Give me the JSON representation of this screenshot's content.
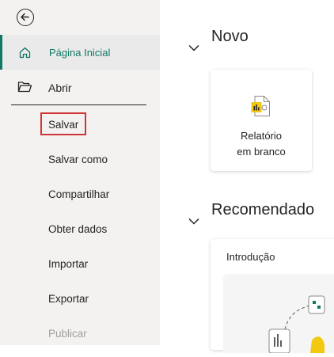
{
  "sidebar": {
    "home_label": "Página Inicial",
    "open_label": "Abrir",
    "items": [
      {
        "label": "Salvar"
      },
      {
        "label": "Salvar como"
      },
      {
        "label": "Compartilhar"
      },
      {
        "label": "Obter dados"
      },
      {
        "label": "Importar"
      },
      {
        "label": "Exportar"
      },
      {
        "label": "Publicar",
        "disabled": true
      }
    ]
  },
  "main": {
    "new_section": {
      "title": "Novo",
      "card_label_line1": "Relatório",
      "card_label_line2": "em branco"
    },
    "recommended_section": {
      "title": "Recomendado",
      "card_label": "Introdução"
    }
  },
  "colors": {
    "accent": "#117865",
    "highlight_border": "#d13438",
    "sidebar_bg": "#f3f2f1",
    "powerbi_yellow": "#f2c811"
  },
  "icons": {
    "back": "back-arrow-icon",
    "home": "home-icon",
    "open": "folder-open-icon",
    "report": "powerbi-report-icon"
  }
}
